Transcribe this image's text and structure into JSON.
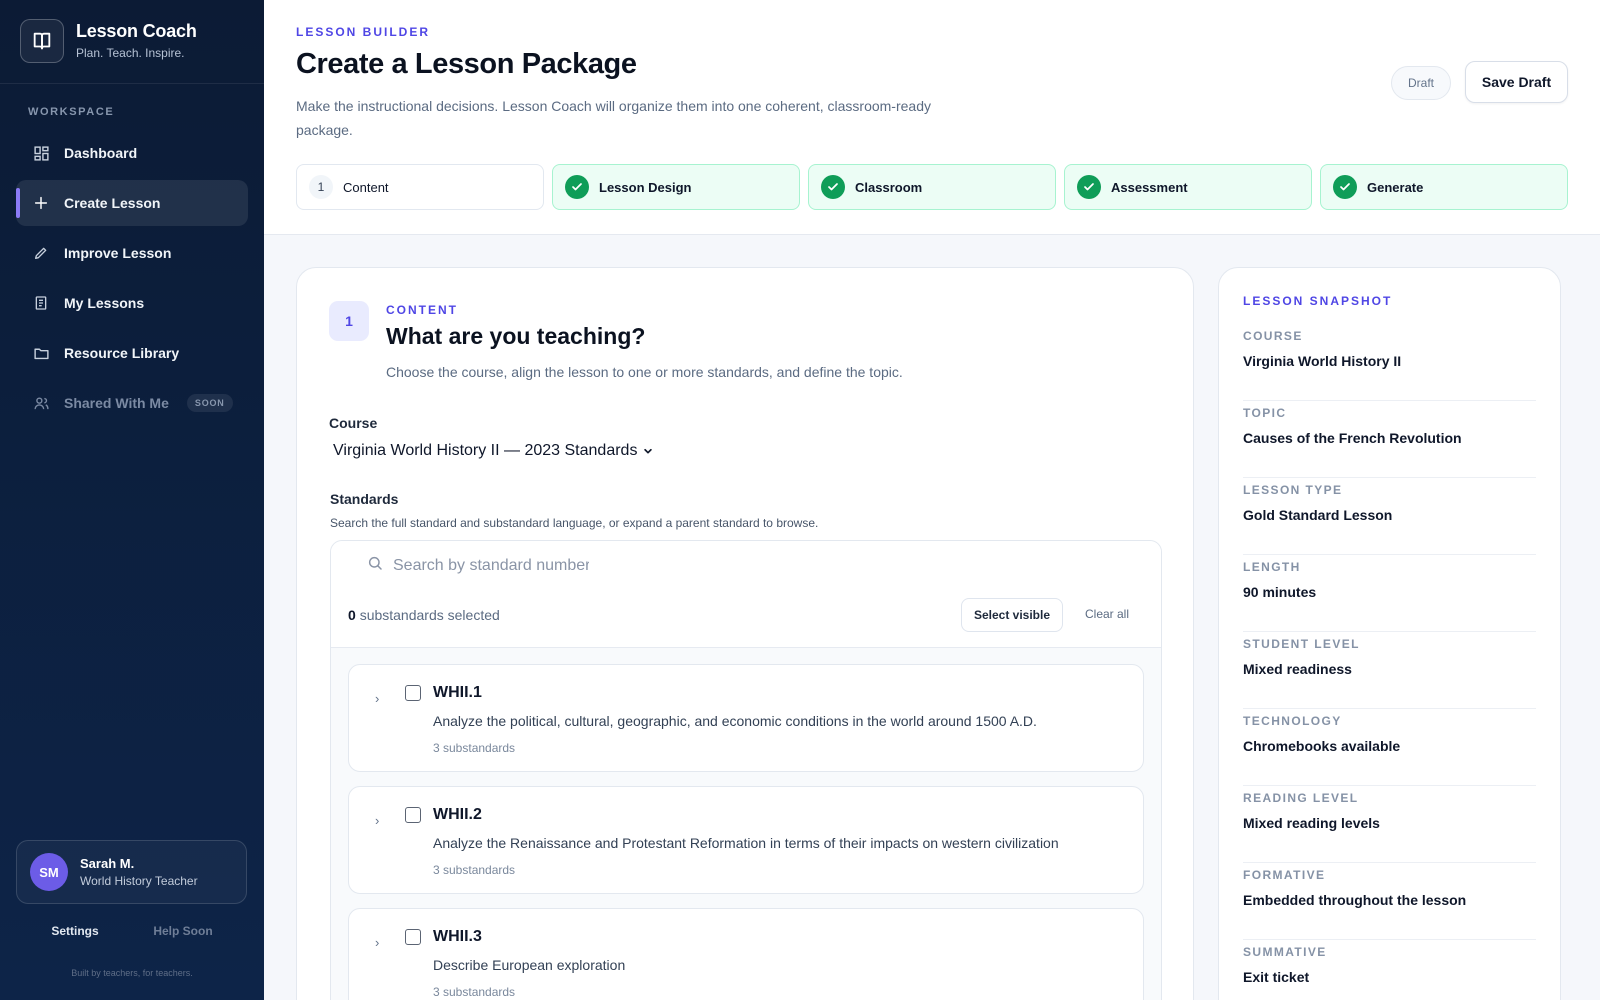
{
  "brand": {
    "name": "Lesson Coach",
    "tagline": "Plan. Teach. Inspire."
  },
  "sidebar": {
    "section_label": "WORKSPACE",
    "items": [
      {
        "label": "Dashboard",
        "icon": "dashboard-icon"
      },
      {
        "label": "Create Lesson",
        "icon": "plus-icon",
        "active": true
      },
      {
        "label": "Improve Lesson",
        "icon": "pencil-icon"
      },
      {
        "label": "My Lessons",
        "icon": "document-icon"
      },
      {
        "label": "Resource Library",
        "icon": "folder-icon"
      },
      {
        "label": "Shared With Me",
        "icon": "users-icon",
        "badge": "SOON",
        "disabled": true
      }
    ],
    "user": {
      "initials": "SM",
      "name": "Sarah M.",
      "role": "World History Teacher"
    },
    "footer": {
      "settings": "Settings",
      "help": "Help Soon",
      "credit": "Built by teachers, for teachers."
    }
  },
  "header": {
    "eyebrow": "LESSON BUILDER",
    "title": "Create a Lesson Package",
    "description": "Make the instructional decisions. Lesson Coach will organize them into one coherent, classroom-ready package.",
    "status": "Draft",
    "save_label": "Save Draft"
  },
  "steps": [
    {
      "number": "1",
      "label": "Content",
      "state": "current"
    },
    {
      "label": "Lesson Design",
      "state": "done"
    },
    {
      "label": "Classroom",
      "state": "done"
    },
    {
      "label": "Assessment",
      "state": "done"
    },
    {
      "label": "Generate",
      "state": "done"
    }
  ],
  "content": {
    "number": "1",
    "eyebrow": "CONTENT",
    "title": "What are you teaching?",
    "description": "Choose the course, align the lesson to one or more standards, and define the topic.",
    "course_label": "Course",
    "course_value": "Virginia World History II — 2023 Standards",
    "standards_label": "Standards",
    "standards_hint": "Search the full standard and substandard language, or expand a parent standard to browse.",
    "search_placeholder": "Search by standard number",
    "selected_count": "0",
    "selected_suffix": "substandards selected",
    "select_visible": "Select visible",
    "clear_all": "Clear all",
    "standards": [
      {
        "code": "WHII.1",
        "description": "Analyze the political, cultural, geographic, and economic conditions in the world around 1500 A.D.",
        "count": "3 substandards"
      },
      {
        "code": "WHII.2",
        "description": "Analyze the Renaissance and Protestant Reformation in terms of their impacts on western civilization",
        "count": "3 substandards"
      },
      {
        "code": "WHII.3",
        "description": "Describe European exploration",
        "count": "3 substandards"
      }
    ]
  },
  "snapshot": {
    "title": "LESSON SNAPSHOT",
    "rows": [
      {
        "key": "COURSE",
        "value": "Virginia World History II"
      },
      {
        "key": "TOPIC",
        "value": "Causes of the French Revolution"
      },
      {
        "key": "LESSON TYPE",
        "value": "Gold Standard Lesson"
      },
      {
        "key": "LENGTH",
        "value": "90 minutes"
      },
      {
        "key": "STUDENT LEVEL",
        "value": "Mixed readiness"
      },
      {
        "key": "TECHNOLOGY",
        "value": "Chromebooks available"
      },
      {
        "key": "READING LEVEL",
        "value": "Mixed reading levels"
      },
      {
        "key": "FORMATIVE",
        "value": "Embedded throughout the lesson"
      },
      {
        "key": "SUMMATIVE",
        "value": "Exit ticket"
      }
    ]
  },
  "colors": {
    "accent": "#4f46e5",
    "sidebar": "#0c1b35",
    "success": "#0f9d58",
    "avatar": "#6c5ce7"
  }
}
